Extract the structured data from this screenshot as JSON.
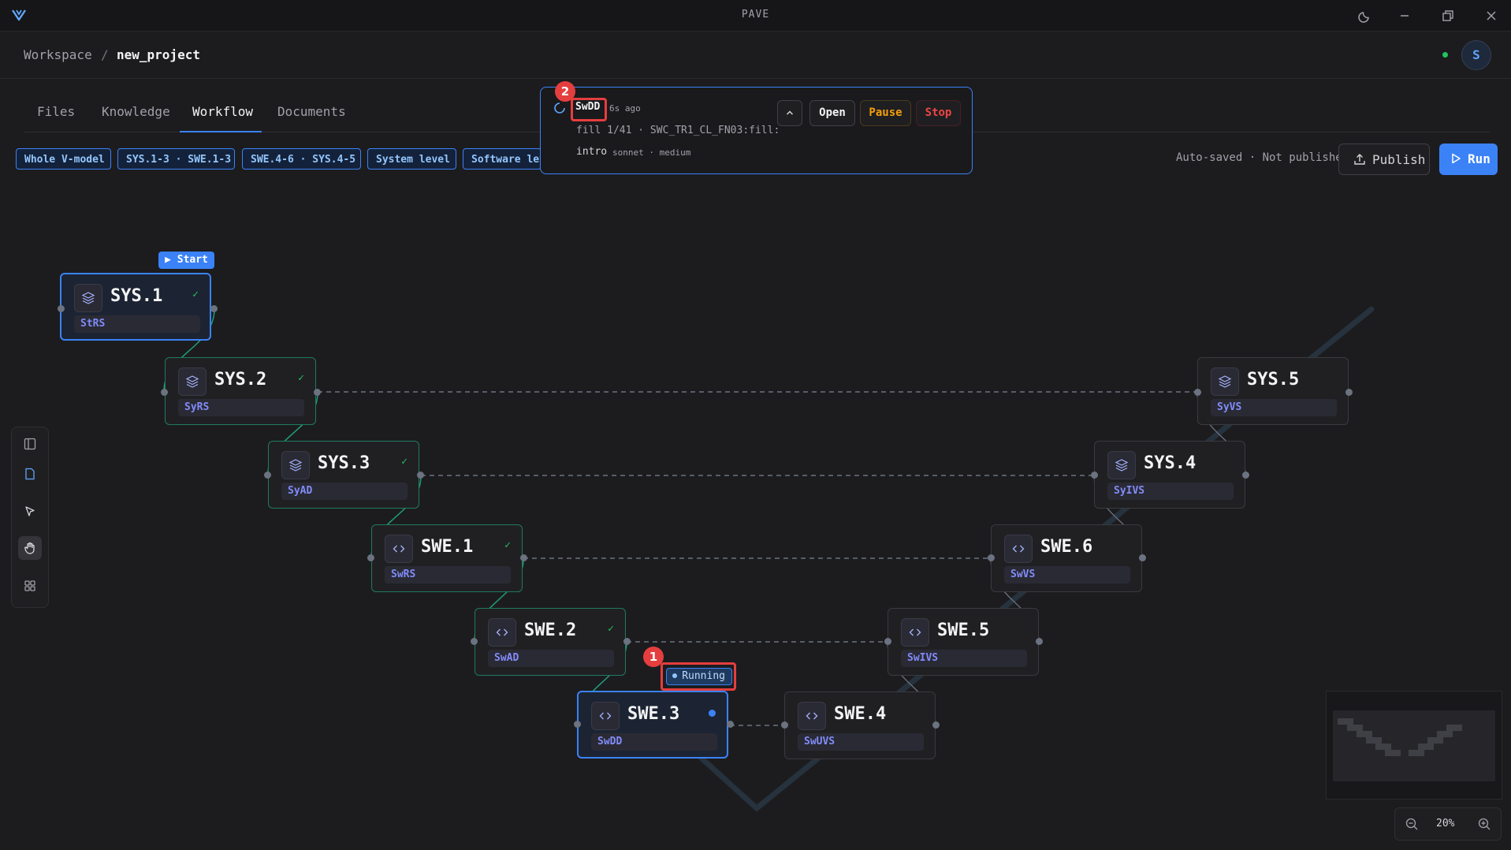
{
  "window": {
    "title": "PAVE"
  },
  "breadcrumb": {
    "root": "Workspace",
    "separator": "/",
    "current": "new_project"
  },
  "user": {
    "avatar_initial": "S",
    "status_color": "#22c55e"
  },
  "tabs": [
    {
      "label": "Files",
      "active": false
    },
    {
      "label": "Knowledge",
      "active": false
    },
    {
      "label": "Workflow",
      "active": true
    },
    {
      "label": "Documents",
      "active": false
    }
  ],
  "filters": [
    "Whole V-model",
    "SYS.1-3 · SWE.1-3",
    "SWE.4-6 · SYS.4-5",
    "System level",
    "Software lev"
  ],
  "save_status": "Auto-saved · Not published",
  "actions": {
    "publish": "Publish",
    "run": "Run"
  },
  "job_popup": {
    "marker": "2",
    "name": "SwDD",
    "time": "6s ago",
    "progress": "fill 1/41 · SWC_TR1_CL_FN03:fill:",
    "phase": "intro",
    "model": "sonnet · medium",
    "buttons": {
      "open": "Open",
      "pause": "Pause",
      "stop": "Stop"
    }
  },
  "canvas": {
    "start_label": "Start",
    "running_label": "Running",
    "running_marker": "1",
    "nodes": [
      {
        "id": "SYS.1",
        "doc": "StRS",
        "status": "done",
        "icon": "layers-icon"
      },
      {
        "id": "SYS.2",
        "doc": "SyRS",
        "status": "done",
        "icon": "layers-icon"
      },
      {
        "id": "SYS.3",
        "doc": "SyAD",
        "status": "done",
        "icon": "layers-icon"
      },
      {
        "id": "SWE.1",
        "doc": "SwRS",
        "status": "done",
        "icon": "code-icon"
      },
      {
        "id": "SWE.2",
        "doc": "SwAD",
        "status": "done",
        "icon": "code-icon"
      },
      {
        "id": "SWE.3",
        "doc": "SwDD",
        "status": "running",
        "icon": "code-icon"
      },
      {
        "id": "SWE.4",
        "doc": "SwUVS",
        "status": "pending",
        "icon": "code-icon"
      },
      {
        "id": "SWE.5",
        "doc": "SwIVS",
        "status": "pending",
        "icon": "code-icon"
      },
      {
        "id": "SWE.6",
        "doc": "SwVS",
        "status": "pending",
        "icon": "code-icon"
      },
      {
        "id": "SYS.4",
        "doc": "SyIVS",
        "status": "pending",
        "icon": "layers-icon"
      },
      {
        "id": "SYS.5",
        "doc": "SyVS",
        "status": "pending",
        "icon": "layers-icon"
      }
    ]
  },
  "zoom": {
    "level": "20%"
  },
  "colors": {
    "accent": "#3b82f6",
    "done": "#22c55e",
    "annotation": "#e53e3e",
    "doc_label": "#818cf8"
  }
}
